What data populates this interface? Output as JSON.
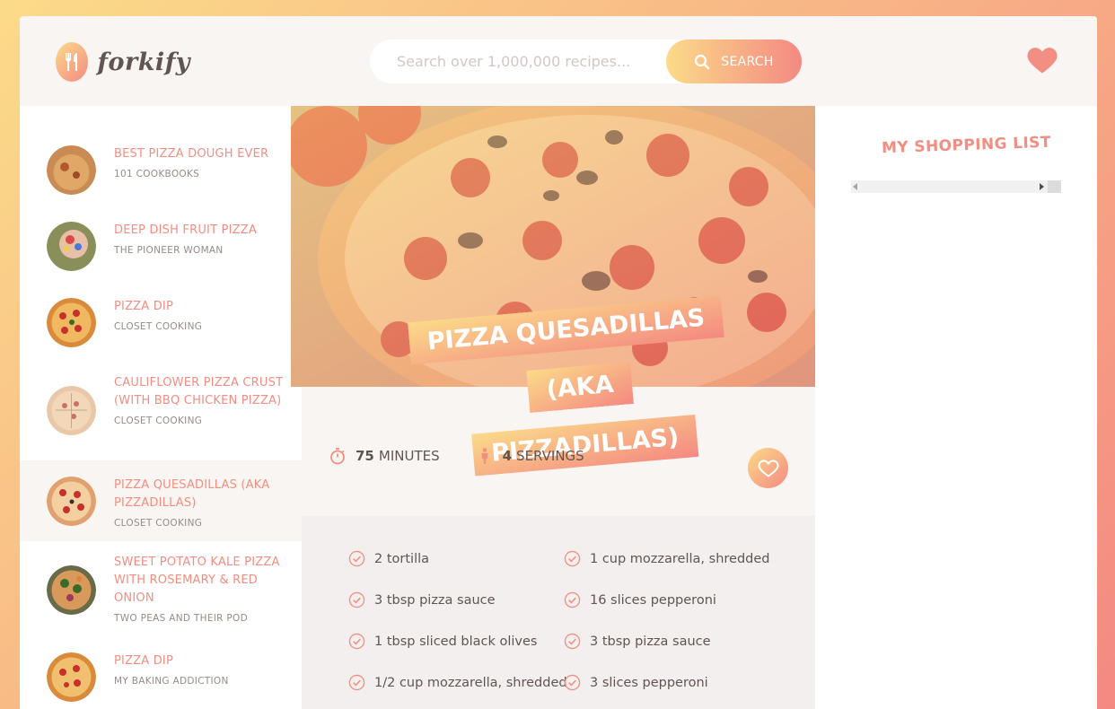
{
  "brand": {
    "name": "forkify"
  },
  "search": {
    "placeholder": "Search over 1,000,000 recipes...",
    "button_label": "SEARCH"
  },
  "results": [
    {
      "title": "BEST PIZZA DOUGH EVER",
      "author": "101 COOKBOOKS"
    },
    {
      "title": "DEEP DISH FRUIT PIZZA",
      "author": "THE PIONEER WOMAN"
    },
    {
      "title": "PIZZA DIP",
      "author": "CLOSET COOKING"
    },
    {
      "title": "CAULIFLOWER PIZZA CRUST (WITH BBQ CHICKEN PIZZA)",
      "author": "CLOSET COOKING"
    },
    {
      "title": "PIZZA QUESADILLAS (AKA PIZZADILLAS)",
      "author": "CLOSET COOKING",
      "active": true
    },
    {
      "title": "SWEET POTATO KALE PIZZA WITH ROSEMARY & RED ONION",
      "author": "TWO PEAS AND THEIR POD"
    },
    {
      "title": "PIZZA DIP",
      "author": "MY BAKING ADDICTION"
    }
  ],
  "recipe": {
    "title_line1": "PIZZA QUESADILLAS (AKA",
    "title_line2": "PIZZADILLAS)",
    "minutes_value": "75",
    "minutes_label": "MINUTES",
    "servings_value": "4",
    "servings_label": "SERVINGS",
    "ingredients": [
      "2 tortilla",
      "1 cup mozzarella, shredded",
      "3 tbsp pizza sauce",
      "16 slices pepperoni",
      "1 tbsp sliced black olives",
      "3 tbsp pizza sauce",
      "1/2 cup mozzarella, shredded",
      "3 slices pepperoni"
    ]
  },
  "shopping": {
    "title": "MY SHOPPING LIST"
  },
  "colors": {
    "accent_start": "#fbdb89",
    "accent_end": "#f48982",
    "text": "#615551",
    "link": "#f38e82"
  },
  "icons": {
    "logo": "fork-knife-icon",
    "search": "search-icon",
    "likes": "heart-icon",
    "time": "stopwatch-icon",
    "servings": "person-icon",
    "ingredient": "check-circle-icon"
  }
}
